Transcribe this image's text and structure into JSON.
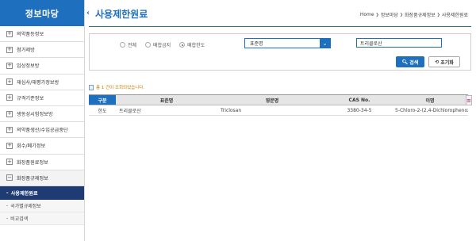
{
  "sidebar": {
    "title": "정보마당",
    "items": [
      {
        "label": "의약품등정보",
        "sign": "+"
      },
      {
        "label": "첨가제방",
        "sign": "+"
      },
      {
        "label": "임상정보방",
        "sign": "+"
      },
      {
        "label": "재심사/재평가정보방",
        "sign": "+"
      },
      {
        "label": "규격기준정보",
        "sign": "+"
      },
      {
        "label": "생동성시험정보방",
        "sign": "+"
      },
      {
        "label": "의약품생산/수입공급중단",
        "sign": "+"
      },
      {
        "label": "회수/폐기정보",
        "sign": "+"
      },
      {
        "label": "화장품원료정보",
        "sign": "+"
      },
      {
        "label": "화장품규제정보",
        "sign": "−"
      }
    ],
    "sub_active": "사용제한원료",
    "sub_items": [
      "국가별규제정보",
      "비교검색"
    ]
  },
  "header": {
    "title": "사용제한원료",
    "collapse_glyph": "‹",
    "breadcrumb": [
      "Home",
      "정보마당",
      "화장품규제정보",
      "사용제한원료"
    ]
  },
  "search": {
    "radios": [
      {
        "label": "전체",
        "checked": false
      },
      {
        "label": "배합금지",
        "checked": false
      },
      {
        "label": "배합한도",
        "checked": true
      }
    ],
    "select_value": "표준명",
    "input_value": "트리클로산",
    "search_label": "검색",
    "reset_label": "초기화"
  },
  "result_text": "총 1 건이 조회되었습니다.",
  "table": {
    "headers": [
      "구분",
      "표준명",
      "영문명",
      "CAS No.",
      "이명"
    ],
    "rows": [
      [
        "한도",
        "트리클로산",
        "Triclosan",
        "3380-34-5",
        "5-Chloro-2-(2,4-Dichlorophenox"
      ]
    ],
    "menu_glyph": "≡"
  },
  "colors": {
    "accent": "#1f6fbf",
    "navy": "#1f3b73",
    "orange": "#c87a00"
  }
}
